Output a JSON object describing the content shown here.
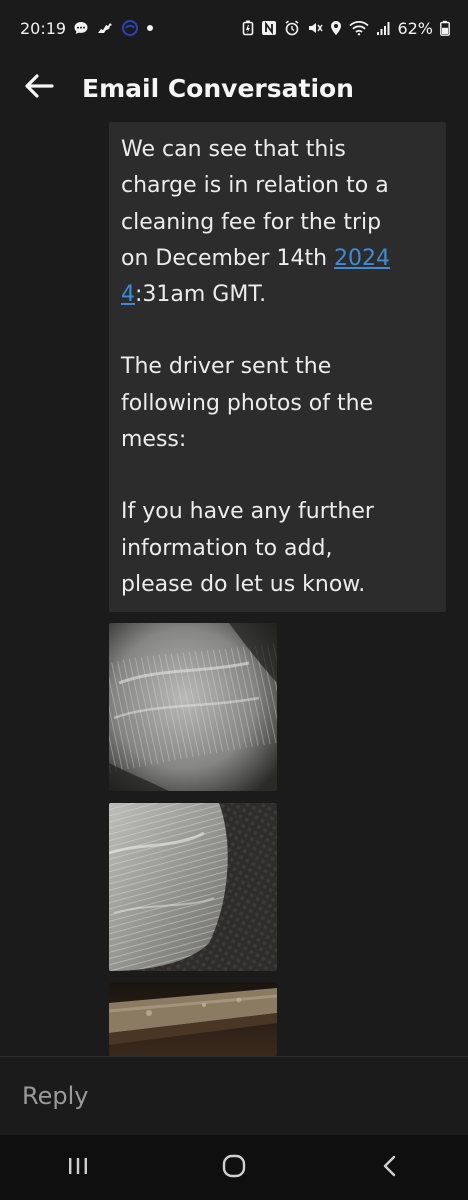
{
  "status_bar": {
    "time": "20:19",
    "battery_percent": "62%",
    "left_icons": [
      "chat-bubble-icon",
      "horse-icon",
      "app-logo-icon",
      "dot-icon"
    ],
    "right_icons": [
      "battery-saver-icon",
      "nfc-icon",
      "alarm-icon",
      "mute-icon",
      "location-icon",
      "wifi-icon",
      "signal-icon",
      "battery-icon"
    ]
  },
  "header": {
    "title": "Email Conversation",
    "back_icon": "arrow-left-icon"
  },
  "message": {
    "line1": "We can see that this",
    "line2": "charge is in relation to a",
    "line3": "cleaning fee for the trip",
    "line4_prefix": "on December 14th ",
    "link_part1": "2024",
    "link_part2": "4",
    "line5_suffix": ":31am GMT.",
    "para2_line1": "The driver sent the",
    "para2_line2": "following photos of the",
    "para2_line3": "mess:",
    "para3_line1": "If you have any further",
    "para3_line2": "information to add,",
    "para3_line3": "please do let us know."
  },
  "photos": [
    {
      "label": "photo-1"
    },
    {
      "label": "photo-2"
    },
    {
      "label": "photo-3"
    }
  ],
  "reply": {
    "placeholder": "Reply"
  },
  "nav_bar": {
    "icons": [
      "recent-apps-icon",
      "home-icon",
      "back-icon"
    ]
  },
  "colors": {
    "background": "#1b1b1b",
    "bubble": "#2c2c2c",
    "link": "#3f8cd4",
    "text": "#ececec",
    "placeholder": "#9a9a9a"
  }
}
